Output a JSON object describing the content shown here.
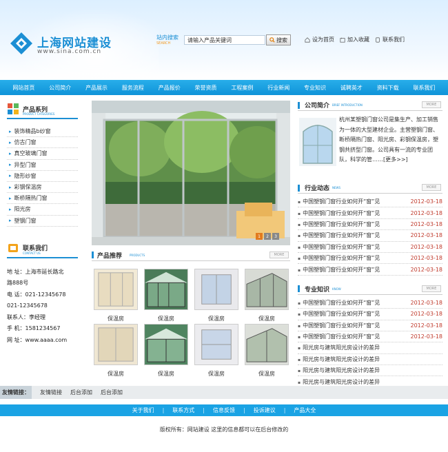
{
  "brand": {
    "title": "上海网站建设",
    "url": "www.sina.com.cn"
  },
  "search": {
    "label": "站内搜索",
    "sub": "SEARCH",
    "value": "请输入产品关键词",
    "button": "搜索"
  },
  "toplinks": [
    "设为首页",
    "加入收藏",
    "联系我们"
  ],
  "nav": [
    "网站首页",
    "公司简介",
    "产品展示",
    "服务流程",
    "产品报价",
    "荣誉资质",
    "工程案例",
    "行业新闻",
    "专业知识",
    "诚聘英才",
    "资料下载",
    "联系我们"
  ],
  "products": {
    "title": "产品系列",
    "sub": "PRODUCT CATEGORIES",
    "items": [
      "装饰精品b纱窗",
      "仿古门窗",
      "真空玻璃门窗",
      "异型门窗",
      "隐形纱窗",
      "彩钢保温房",
      "断桥隔热门窗",
      "阳光房",
      "塑钢门窗"
    ]
  },
  "contact": {
    "title": "联系我们",
    "sub": "CONTACT US",
    "lines": [
      "地 址：上海市延长路北",
      "路888号",
      "电 话：021-12345678",
      "021-12345678",
      "联系人：李经理",
      "手 机：1581234567",
      "网 址：www.aaaa.com"
    ]
  },
  "banner": {
    "dots": [
      "1",
      "2",
      "3"
    ]
  },
  "recommend": {
    "title": "产品推荐",
    "sub": "PRODUCTS",
    "more": "MORE",
    "items": [
      "保温房",
      "保温房",
      "保温房",
      "保温房",
      "保温房",
      "保温房",
      "保温房",
      "保温房"
    ]
  },
  "intro": {
    "title": "公司简介",
    "sub": "BRIEF INTRODUCTION",
    "more": "MORE",
    "text": "杭州某塑钢门窗公司是集生产、加工销售为一体的大型建材企业。主营塑钢门窗、断桥隔热门窗、阳光房、彩钢保温房，塑钢共挤型门窗。公司具有一流的专业团队，科学的管……[更多>>]"
  },
  "industry": {
    "title": "行业动态",
    "sub": "NEWS",
    "more": "MORE",
    "items": [
      {
        "t": "中国塑钢门窗行业如何开“窗”见",
        "d": "2012-03-18"
      },
      {
        "t": "中国塑钢门窗行业如何开“窗”见",
        "d": "2012-03-18"
      },
      {
        "t": "中国塑钢门窗行业如何开“窗”见",
        "d": "2012-03-18"
      },
      {
        "t": "中国塑钢门窗行业如何开“窗”见",
        "d": "2012-03-18"
      },
      {
        "t": "中国塑钢门窗行业如何开“窗”见",
        "d": "2012-03-18"
      },
      {
        "t": "中国塑钢门窗行业如何开“窗”见",
        "d": "2012-03-18"
      },
      {
        "t": "中国塑钢门窗行业如何开“窗”见",
        "d": "2012-03-18"
      }
    ]
  },
  "knowledge": {
    "title": "专业知识",
    "sub": "KNOW",
    "more": "MORE",
    "items": [
      {
        "t": "中国塑钢门窗行业如何开“窗”见",
        "d": "2012-03-18"
      },
      {
        "t": "中国塑钢门窗行业如何开“窗”见",
        "d": "2012-03-18"
      },
      {
        "t": "中国塑钢门窗行业如何开“窗”见",
        "d": "2012-03-18"
      },
      {
        "t": "中国塑钢门窗行业如何开“窗”见",
        "d": "2012-03-18"
      },
      {
        "t": "阳光房与建筑阳光房设计的差异",
        "d": ""
      },
      {
        "t": "阳光房与建筑阳光房设计的差异",
        "d": ""
      },
      {
        "t": "阳光房与建筑阳光房设计的差异",
        "d": ""
      },
      {
        "t": "阳光房与建筑阳光房设计的差异",
        "d": ""
      }
    ]
  },
  "friend": {
    "label": "友情链接：",
    "links": [
      "友情链接",
      "后台添加",
      "后台添加"
    ]
  },
  "footer": {
    "links": [
      "关于我们",
      "联系方式",
      "信息反馈",
      "投诉建议",
      "产品大全"
    ],
    "sep": "|",
    "copyright": "版权所有：网站建设 这里的信息都可以在后台修改的"
  },
  "colors": {
    "primary": "#1aa3e4",
    "date": "#c0392b"
  }
}
